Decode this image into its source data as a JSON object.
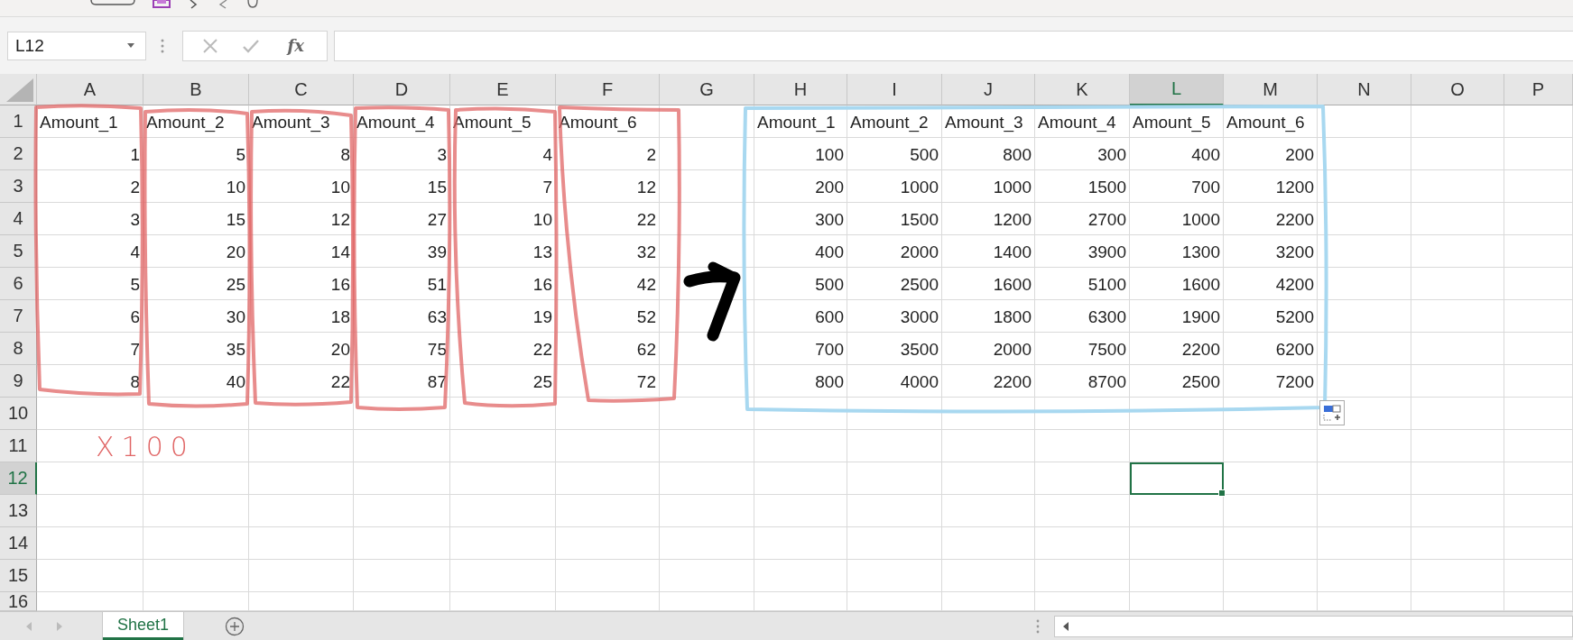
{
  "name_box": {
    "value": "L12"
  },
  "formula_bar": {
    "function_label": "fx"
  },
  "columns": [
    {
      "label": "A",
      "selected": false
    },
    {
      "label": "B",
      "selected": false
    },
    {
      "label": "C",
      "selected": false
    },
    {
      "label": "D",
      "selected": false
    },
    {
      "label": "E",
      "selected": false
    },
    {
      "label": "F",
      "selected": false
    },
    {
      "label": "G",
      "selected": false
    },
    {
      "label": "H",
      "selected": false
    },
    {
      "label": "I",
      "selected": false
    },
    {
      "label": "J",
      "selected": false
    },
    {
      "label": "K",
      "selected": false
    },
    {
      "label": "L",
      "selected": true
    },
    {
      "label": "M",
      "selected": false
    },
    {
      "label": "N",
      "selected": false
    },
    {
      "label": "O",
      "selected": false
    },
    {
      "label": "P",
      "selected": false
    }
  ],
  "rows": [
    {
      "label": "1",
      "selected": false,
      "kind": "text",
      "cells": [
        "Amount_1",
        "Amount_2",
        "Amount_3",
        "Amount_4",
        "Amount_5",
        "Amount_6",
        null,
        "Amount_1",
        "Amount_2",
        "Amount_3",
        "Amount_4",
        "Amount_5",
        "Amount_6"
      ]
    },
    {
      "label": "2",
      "selected": false,
      "kind": "number",
      "cells": [
        "1",
        "5",
        "8",
        "3",
        "4",
        "2",
        null,
        "100",
        "500",
        "800",
        "300",
        "400",
        "200"
      ]
    },
    {
      "label": "3",
      "selected": false,
      "kind": "number",
      "cells": [
        "2",
        "10",
        "10",
        "15",
        "7",
        "12",
        null,
        "200",
        "1000",
        "1000",
        "1500",
        "700",
        "1200"
      ]
    },
    {
      "label": "4",
      "selected": false,
      "kind": "number",
      "cells": [
        "3",
        "15",
        "12",
        "27",
        "10",
        "22",
        null,
        "300",
        "1500",
        "1200",
        "2700",
        "1000",
        "2200"
      ]
    },
    {
      "label": "5",
      "selected": false,
      "kind": "number",
      "cells": [
        "4",
        "20",
        "14",
        "39",
        "13",
        "32",
        null,
        "400",
        "2000",
        "1400",
        "3900",
        "1300",
        "3200"
      ]
    },
    {
      "label": "6",
      "selected": false,
      "kind": "number",
      "cells": [
        "5",
        "25",
        "16",
        "51",
        "16",
        "42",
        null,
        "500",
        "2500",
        "1600",
        "5100",
        "1600",
        "4200"
      ]
    },
    {
      "label": "7",
      "selected": false,
      "kind": "number",
      "cells": [
        "6",
        "30",
        "18",
        "63",
        "19",
        "52",
        null,
        "600",
        "3000",
        "1800",
        "6300",
        "1900",
        "5200"
      ]
    },
    {
      "label": "8",
      "selected": false,
      "kind": "number",
      "cells": [
        "7",
        "35",
        "20",
        "75",
        "22",
        "62",
        null,
        "700",
        "3500",
        "2000",
        "7500",
        "2200",
        "6200"
      ]
    },
    {
      "label": "9",
      "selected": false,
      "kind": "number",
      "cells": [
        "8",
        "40",
        "22",
        "87",
        "25",
        "72",
        null,
        "800",
        "4000",
        "2200",
        "8700",
        "2500",
        "7200"
      ]
    },
    {
      "label": "10",
      "selected": false
    },
    {
      "label": "11",
      "selected": false
    },
    {
      "label": "12",
      "selected": true
    },
    {
      "label": "13",
      "selected": false
    },
    {
      "label": "14",
      "selected": false
    },
    {
      "label": "15",
      "selected": false
    },
    {
      "label": "16",
      "selected": false
    }
  ],
  "annotation": {
    "note": "X100"
  },
  "sheet_tabs": [
    {
      "label": "Sheet1",
      "selected": true
    }
  ]
}
